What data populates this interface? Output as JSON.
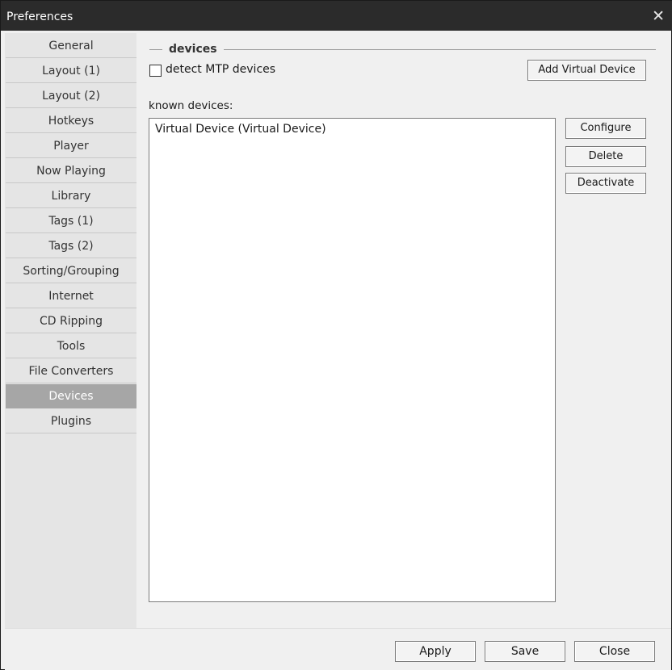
{
  "window": {
    "title": "Preferences"
  },
  "sidebar": {
    "items": [
      {
        "label": "General"
      },
      {
        "label": "Layout (1)"
      },
      {
        "label": "Layout (2)"
      },
      {
        "label": "Hotkeys"
      },
      {
        "label": "Player"
      },
      {
        "label": "Now Playing"
      },
      {
        "label": "Library"
      },
      {
        "label": "Tags (1)"
      },
      {
        "label": "Tags (2)"
      },
      {
        "label": "Sorting/Grouping"
      },
      {
        "label": "Internet"
      },
      {
        "label": "CD Ripping"
      },
      {
        "label": "Tools"
      },
      {
        "label": "File Converters"
      },
      {
        "label": "Devices"
      },
      {
        "label": "Plugins"
      }
    ],
    "selected": "Devices"
  },
  "devices": {
    "group_title": "devices",
    "detect_mtp_label": "detect MTP devices",
    "detect_mtp_checked": false,
    "add_virtual_device_label": "Add Virtual Device",
    "known_devices_label": "known devices:",
    "known_devices": [
      {
        "label": "Virtual Device (Virtual Device)"
      }
    ],
    "configure_label": "Configure",
    "delete_label": "Delete",
    "deactivate_label": "Deactivate"
  },
  "footer": {
    "apply_label": "Apply",
    "save_label": "Save",
    "close_label": "Close"
  },
  "icons": {
    "window_close": "close-icon"
  },
  "colors": {
    "titlebar": "#2b2b2b",
    "selected_item": "#a6a6a6",
    "sidebar": "#e5e5e5",
    "dialog": "#f0f0f0"
  }
}
